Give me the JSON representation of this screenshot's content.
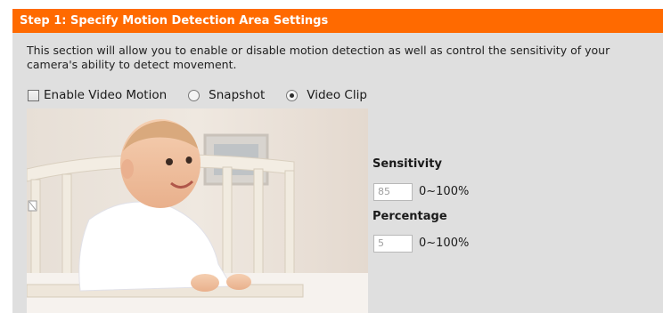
{
  "header": {
    "title": "Step 1: Specify Motion Detection Area Settings"
  },
  "description": "This section will allow you to enable or disable motion detection as well as control the sensitivity of your camera's ability to detect movement.",
  "options": {
    "enable_label": "Enable Video Motion",
    "enable_checked": false,
    "snapshot_label": "Snapshot",
    "videoclip_label": "Video Clip",
    "selected": "Video Clip"
  },
  "sensitivity": {
    "label": "Sensitivity",
    "value": "85",
    "range": "0~100%"
  },
  "percentage": {
    "label": "Percentage",
    "value": "5",
    "range": "0~100%"
  },
  "colors": {
    "header": "#ff6a00",
    "panel": "#dfdfdf"
  }
}
